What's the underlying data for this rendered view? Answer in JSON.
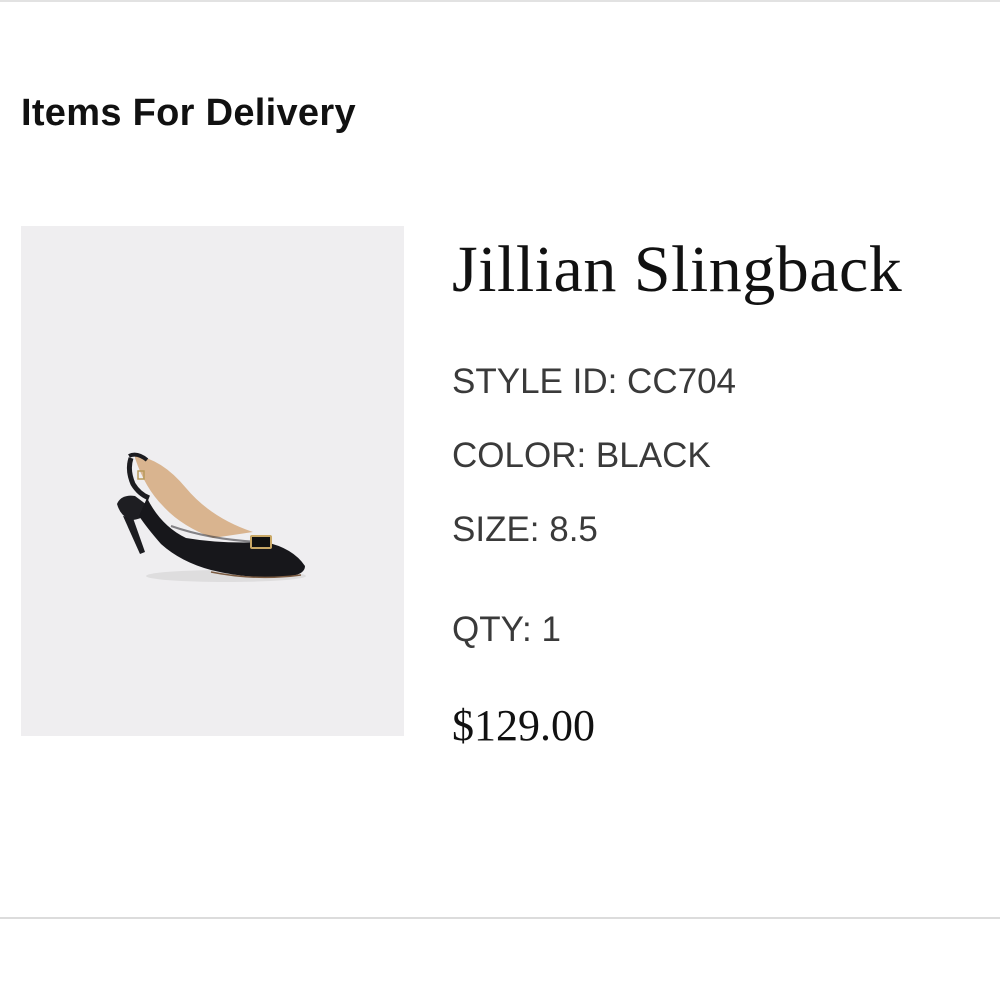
{
  "section": {
    "title": "Items For Delivery"
  },
  "item": {
    "name": "Jillian Slingback",
    "style_id": "STYLE ID: CC704",
    "color": "COLOR: BLACK",
    "size": "SIZE: 8.5",
    "qty": "QTY: 1",
    "price": "$129.00",
    "image_icon": "shoe-image",
    "image_background": "#efeef0"
  }
}
